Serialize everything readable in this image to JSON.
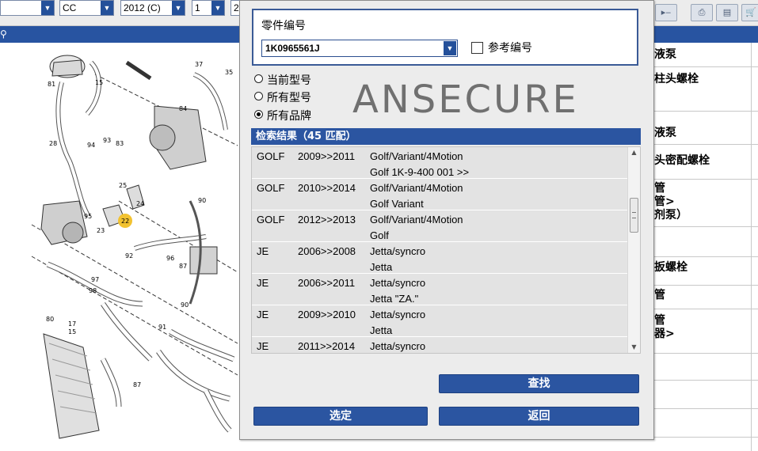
{
  "toolbar": {
    "combo_1": "",
    "combo_2": "CC",
    "combo_3": "2012 (C)",
    "combo_4": "1",
    "combo_5": "2"
  },
  "right_list": {
    "rows": [
      "液泵",
      "柱头螺栓",
      "液泵",
      "头密配螺栓",
      "管",
      "管>",
      "剂泵）",
      "扳螺栓",
      "管",
      "管",
      "器>"
    ]
  },
  "diagram": {
    "callouts": [
      "81",
      "37",
      "15",
      "35",
      "84",
      "28",
      "94",
      "93",
      "83",
      "90",
      "25",
      "24",
      "95",
      "22",
      "23",
      "96",
      "92",
      "87",
      "97",
      "98",
      "80",
      "17",
      "15",
      "91",
      "90",
      "87"
    ]
  },
  "dialog": {
    "group_label": "零件编号",
    "part_number": "1K0965561J",
    "reference_checkbox_label": "参考编号",
    "reference_checked": false,
    "radios": [
      {
        "label": "当前型号",
        "selected": false
      },
      {
        "label": "所有型号",
        "selected": false
      },
      {
        "label": "所有品牌",
        "selected": true
      }
    ],
    "watermark": "ANSECURE",
    "results_header": "检索结果（45 匹配）",
    "results": [
      {
        "make": "GOLF",
        "years": "2009>>2011",
        "model": "Golf/Variant/4Motion",
        "desc": "Golf 1K-9-400 001 >>"
      },
      {
        "make": "GOLF",
        "years": "2010>>2014",
        "model": "Golf/Variant/4Motion",
        "desc": "Golf Variant"
      },
      {
        "make": "GOLF",
        "years": "2012>>2013",
        "model": "Golf/Variant/4Motion",
        "desc": "Golf"
      },
      {
        "make": "JE",
        "years": "2006>>2008",
        "model": "Jetta/syncro",
        "desc": "Jetta"
      },
      {
        "make": "JE",
        "years": "2006>>2011",
        "model": "Jetta/syncro",
        "desc": "Jetta \"ZA.\""
      },
      {
        "make": "JE",
        "years": "2009>>2010",
        "model": "Jetta/syncro",
        "desc": "Jetta"
      },
      {
        "make": "JE",
        "years": "2011>>2014",
        "model": "Jetta/syncro",
        "desc": ""
      }
    ],
    "buttons": {
      "search": "查找",
      "select": "选定",
      "back": "返回"
    }
  }
}
